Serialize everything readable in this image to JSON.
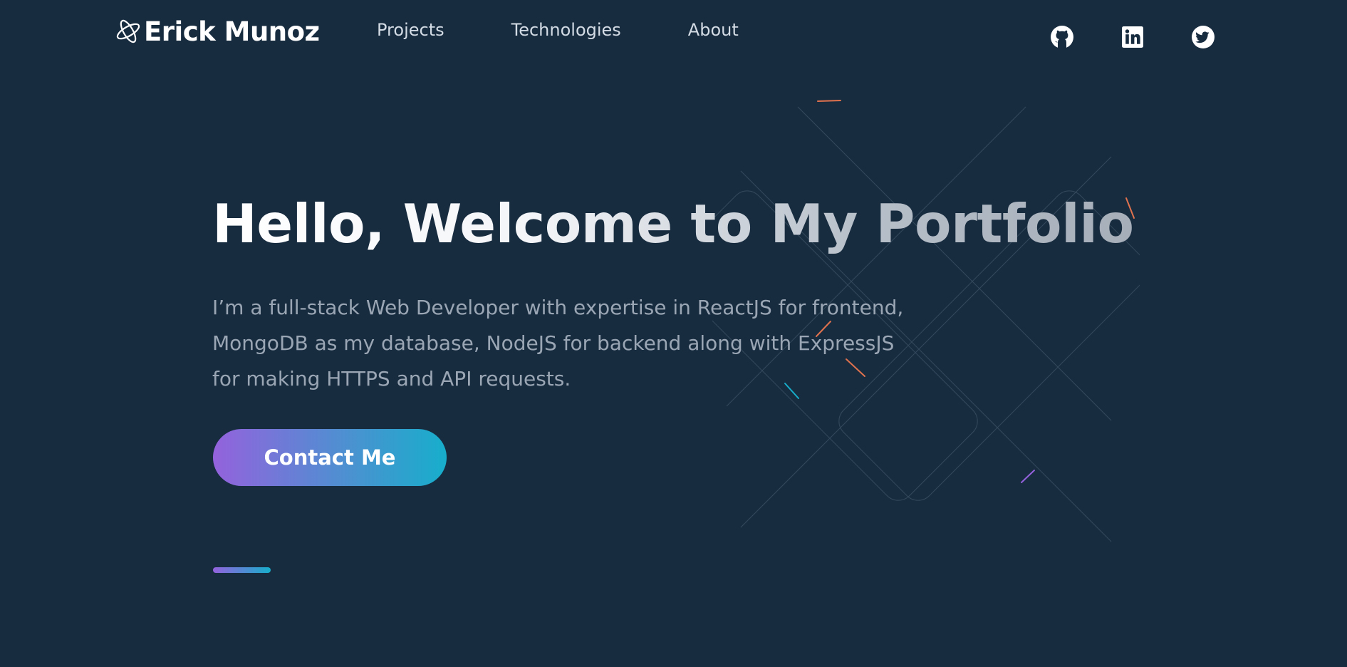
{
  "header": {
    "logo_text": "Erick Munoz",
    "nav": [
      {
        "label": "Projects"
      },
      {
        "label": "Technologies"
      },
      {
        "label": "About"
      }
    ],
    "socials": [
      {
        "icon": "github-icon"
      },
      {
        "icon": "linkedin-icon"
      },
      {
        "icon": "twitter-icon"
      }
    ]
  },
  "hero": {
    "title": "Hello, Welcome to My Portfolio",
    "description": "I’m a full-stack Web Developer with expertise in ReactJS for frontend, MongoDB as my database, NodeJS for backend along with ExpressJS for making HTTPS and API requests.",
    "cta_label": "Contact Me"
  },
  "colors": {
    "background": "#182c40",
    "accent_start": "#9462dd",
    "accent_end": "#17aecb",
    "text_primary": "#ffffff",
    "text_secondary": "#9aa6b4"
  }
}
